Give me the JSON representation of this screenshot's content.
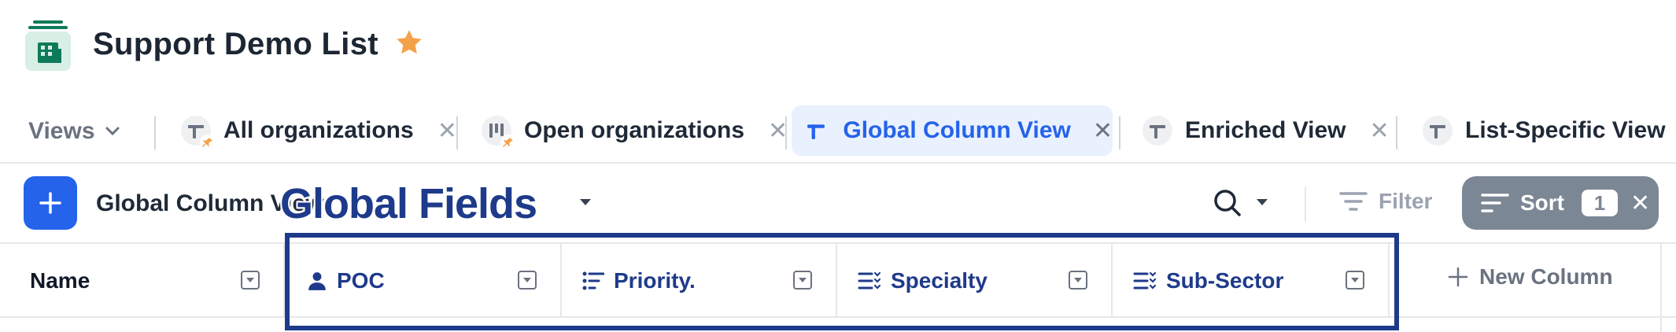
{
  "header": {
    "list_title": "Support Demo List",
    "app_icon": "building-icon",
    "favorite_icon": "star-icon",
    "favorite_color": "#f4a24a"
  },
  "tabs": {
    "views_label": "Views",
    "items": [
      {
        "label": "All organizations",
        "icon": "view-icon",
        "pinned": true,
        "active": false
      },
      {
        "label": "Open organizations",
        "icon": "kanban-icon",
        "pinned": true,
        "active": false
      },
      {
        "label": "Global Column View",
        "icon": "view-icon",
        "pinned": false,
        "active": true
      },
      {
        "label": "Enriched View",
        "icon": "view-icon",
        "pinned": false,
        "active": false
      },
      {
        "label": "List-Specific View",
        "icon": "view-icon",
        "pinned": false,
        "active": false
      }
    ]
  },
  "toolbar": {
    "view_name": "Global Column View",
    "filter_label": "Filter",
    "sort_label": "Sort",
    "sort_count": "1",
    "accent": "#2563eb"
  },
  "overlay": {
    "label": "Global Fields",
    "color": "#1e3a8a"
  },
  "columns": {
    "items": [
      {
        "label": "Name",
        "icon": ""
      },
      {
        "label": "POC",
        "icon": "person-icon"
      },
      {
        "label": "Priority.",
        "icon": "list-icon"
      },
      {
        "label": "Specialty",
        "icon": "multi-select-icon"
      },
      {
        "label": "Sub-Sector",
        "icon": "multi-select-icon"
      }
    ],
    "new_column_label": "New Column"
  }
}
